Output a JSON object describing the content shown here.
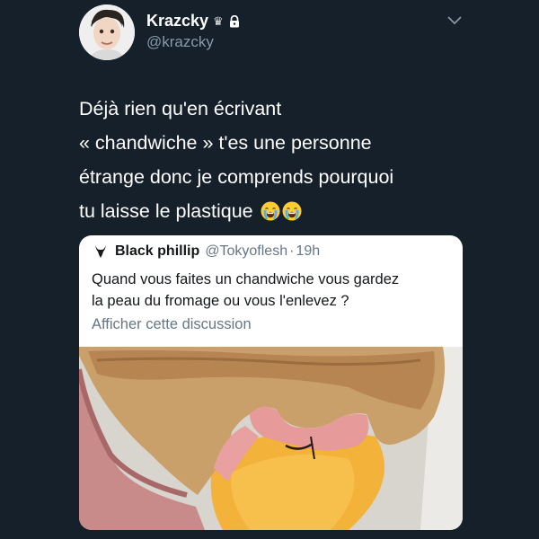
{
  "tweet": {
    "author": {
      "name": "Krazcky",
      "handle": "@krazcky",
      "badge_icon": "crown-icon",
      "protected_icon": "lock-icon"
    },
    "text_lines": [
      "Déjà rien qu'en écrivant",
      "« chandwiche » t'es une personne",
      "étrange donc je comprends pourquoi",
      "tu laisse le plastique"
    ],
    "emojis": [
      "loudly-crying-face",
      "loudly-crying-face"
    ]
  },
  "quoted_tweet": {
    "author_name": "Black phillip",
    "author_handle": "@Tokyoflesh",
    "separator": "·",
    "time": "19h",
    "text_lines": [
      "Quand vous faites un chandwiche  vous gardez",
      "la peau du fromage ou vous l'enlevez ?"
    ],
    "show_thread": "Afficher cette discussion"
  },
  "colors": {
    "background": "#15202b",
    "secondary_text": "#8899a6",
    "quote_card": "#ffffff",
    "quote_secondary": "#657786"
  }
}
